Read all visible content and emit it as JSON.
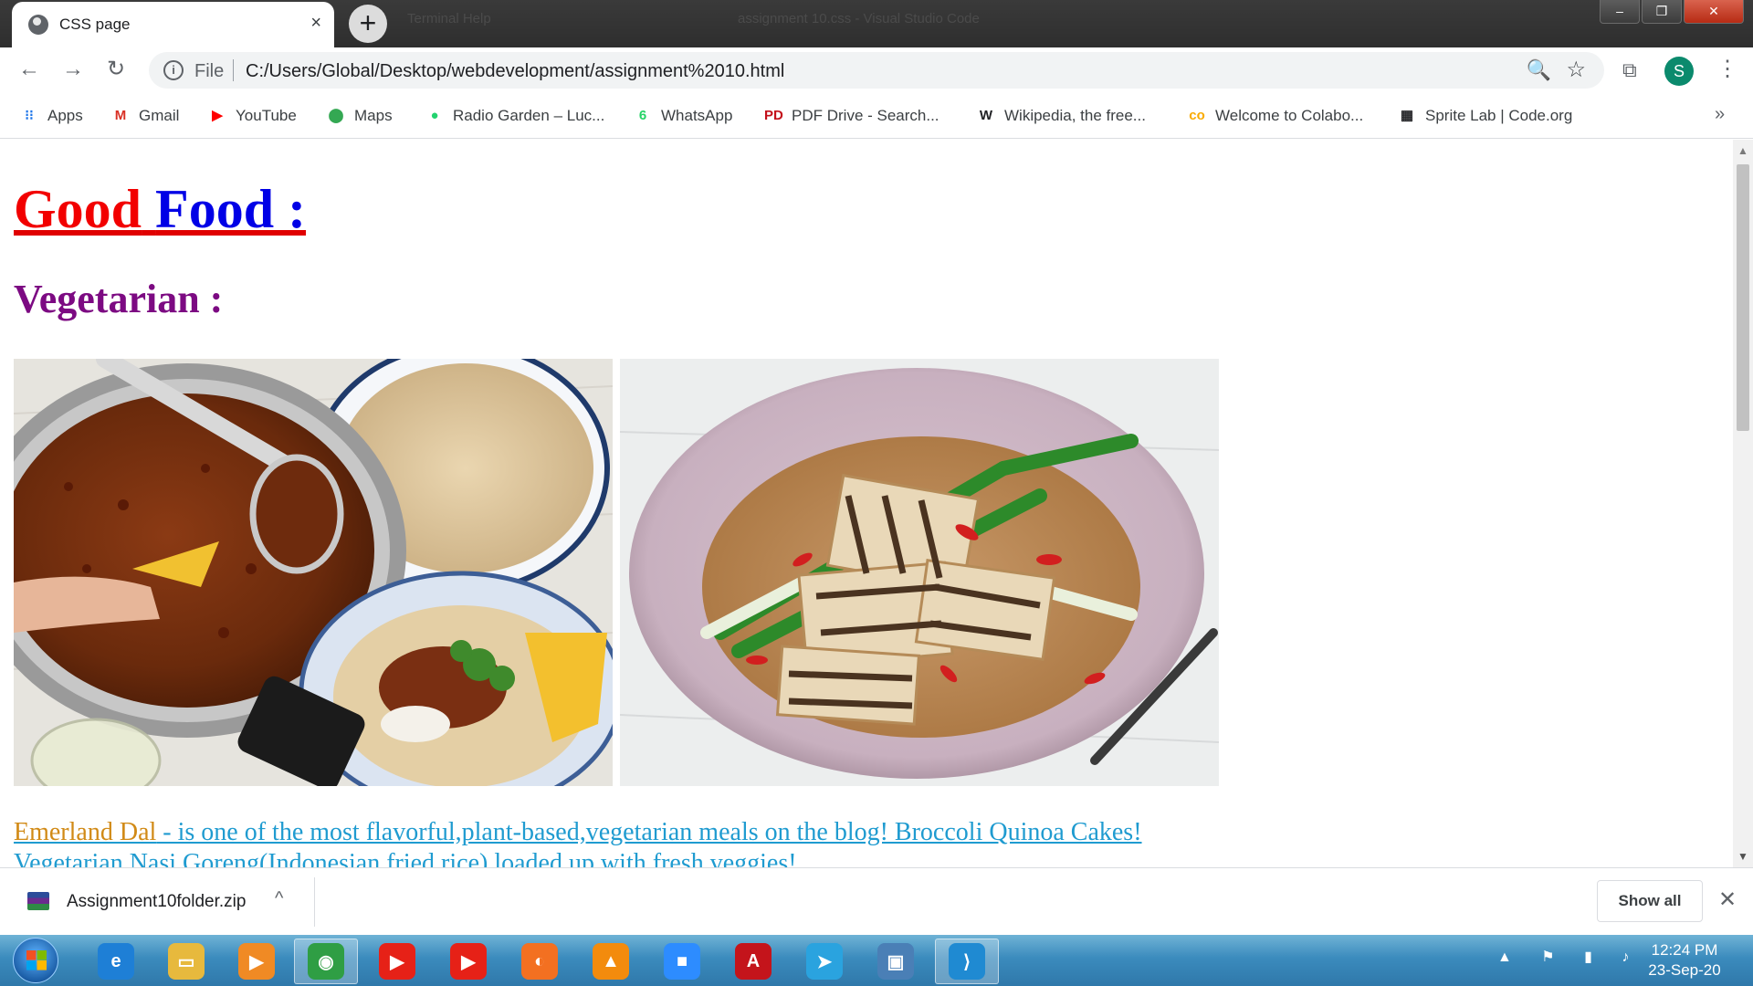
{
  "window": {
    "tab_title": "CSS page",
    "tab_close": "×",
    "new_tab": "+",
    "background_text_1": "Terminal   Help",
    "background_text_2": "assignment 10.css - Visual Studio Code",
    "controls": {
      "minimize": "–",
      "restore": "❐",
      "close": "✕"
    }
  },
  "toolbar": {
    "back": "←",
    "forward": "→",
    "reload": "↻",
    "info": "i",
    "scheme": "File",
    "url": "C:/Users/Global/Desktop/webdevelopment/assignment%2010.html",
    "zoom": "🔍",
    "star": "☆",
    "extensions": "⧉",
    "profile_initial": "S",
    "menu": "⋮"
  },
  "bookmarks": {
    "items": [
      {
        "label": "Apps",
        "icon": "apps-grid-icon",
        "glyph": "⁝⁝",
        "color": "#1a73e8"
      },
      {
        "label": "Gmail",
        "icon": "gmail-icon",
        "glyph": "M",
        "color": "#d93025"
      },
      {
        "label": "YouTube",
        "icon": "youtube-icon",
        "glyph": "▶",
        "color": "#ff0000"
      },
      {
        "label": "Maps",
        "icon": "maps-pin-icon",
        "glyph": "⬤",
        "color": "#34a853"
      },
      {
        "label": "Radio Garden – Luc...",
        "icon": "radio-garden-icon",
        "glyph": "●",
        "color": "#22d36f"
      },
      {
        "label": "WhatsApp",
        "icon": "whatsapp-icon",
        "glyph": "6",
        "color": "#25d366"
      },
      {
        "label": "PDF Drive - Search...",
        "icon": "pdf-drive-icon",
        "glyph": "PD",
        "color": "#c3101b"
      },
      {
        "label": "Wikipedia, the free...",
        "icon": "wikipedia-icon",
        "glyph": "W",
        "color": "#202124"
      },
      {
        "label": "Welcome to Colabo...",
        "icon": "colab-icon",
        "glyph": "co",
        "color": "#f9ab00"
      },
      {
        "label": "Sprite Lab | Code.org",
        "icon": "code-org-icon",
        "glyph": "▦",
        "color": "#202124"
      }
    ],
    "more": "»"
  },
  "page": {
    "heading_part1": "Good",
    "heading_part2": "Food :",
    "subheading": "Vegetarian :",
    "images": [
      {
        "name": "chilli-con-carne-photo"
      },
      {
        "name": "grilled-tofu-rice-photo"
      }
    ],
    "desc_highlight": "Emerland Dal",
    "desc_rest": " - is one of the most flavorful,plant-based,vegetarian meals on the blog! Broccoli Quinoa Cakes! Vegetarian Nasi Goreng(Indonesian fried rice) loaded up with fresh veggies!"
  },
  "scrollbar": {
    "up": "▲",
    "down": "▼"
  },
  "downloads": {
    "filename": "Assignment10folder.zip",
    "chevron": "^",
    "show_all": "Show all",
    "close": "✕"
  },
  "taskbar": {
    "apps": [
      {
        "name": "internet-explorer-icon",
        "glyph": "e",
        "color": "#1e7fd6"
      },
      {
        "name": "file-explorer-icon",
        "glyph": "▭",
        "color": "#e7b93d"
      },
      {
        "name": "media-player-icon",
        "glyph": "▶",
        "color": "#f08a24"
      },
      {
        "name": "chrome-icon",
        "glyph": "◉",
        "color": "#2f9e44",
        "active": true
      },
      {
        "name": "youtube-app-icon",
        "glyph": "▶",
        "color": "#e62117"
      },
      {
        "name": "youtube-music-icon",
        "glyph": "▶",
        "color": "#e62117"
      },
      {
        "name": "firefox-icon",
        "glyph": "◐",
        "color": "#f37021"
      },
      {
        "name": "vlc-icon",
        "glyph": "▲",
        "color": "#f38b0d"
      },
      {
        "name": "zoom-icon",
        "glyph": "■",
        "color": "#2d8cff"
      },
      {
        "name": "acrobat-icon",
        "glyph": "A",
        "color": "#c4141b"
      },
      {
        "name": "telegram-icon",
        "glyph": "➤",
        "color": "#2aa3df"
      },
      {
        "name": "remote-desktop-icon",
        "glyph": "▣",
        "color": "#4a7fb6"
      },
      {
        "name": "vscode-icon",
        "glyph": "⟩",
        "color": "#1f8ad2",
        "active": true
      }
    ],
    "tray": "▲ ⚑ ▮ ♪",
    "time": "12:24 PM",
    "date": "23-Sep-20"
  }
}
